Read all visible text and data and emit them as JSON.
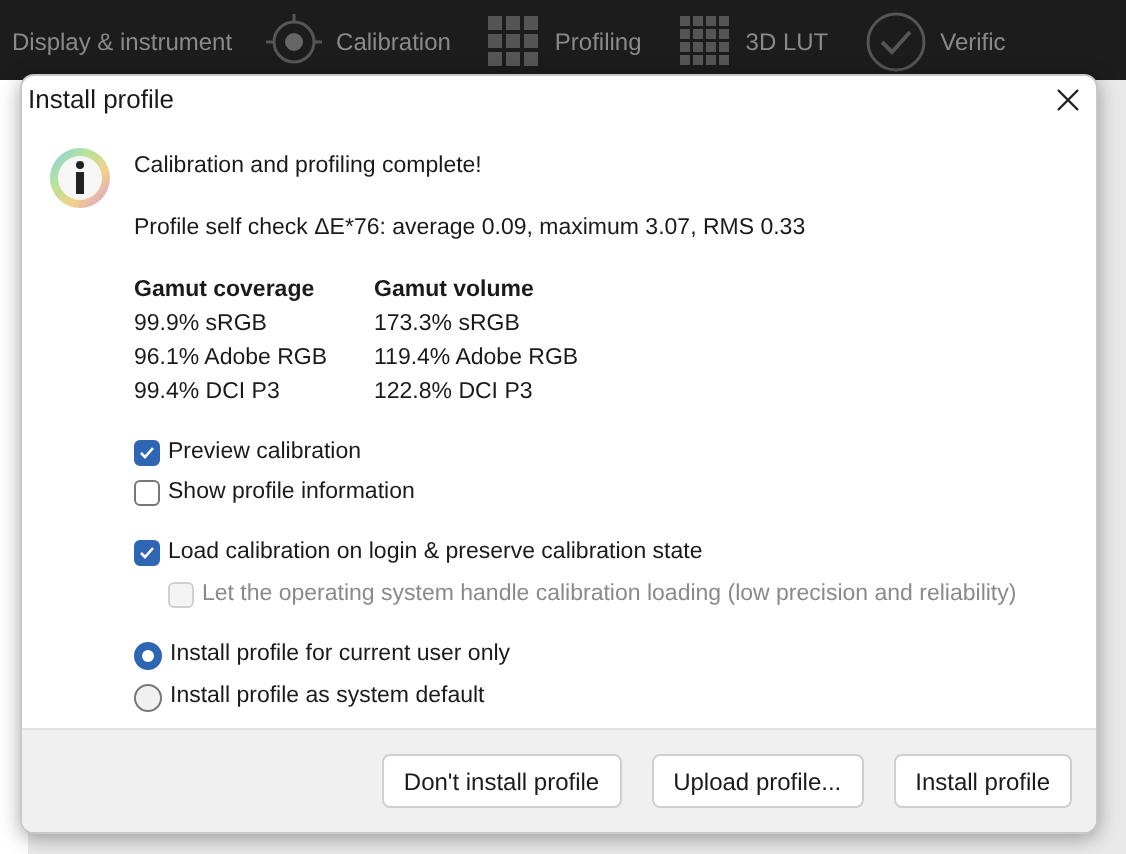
{
  "nav": [
    {
      "label": "Display & instrument",
      "kind": "text"
    },
    {
      "label": "Calibration",
      "kind": "target"
    },
    {
      "label": "Profiling",
      "kind": "grid"
    },
    {
      "label": "3D LUT",
      "kind": "cube"
    },
    {
      "label": "Verific",
      "kind": "check"
    }
  ],
  "dialog": {
    "title": "Install profile",
    "heading": "Calibration and profiling complete!",
    "self_check": "Profile self check ΔE*76: average 0.09, maximum 3.07, RMS 0.33",
    "gamut": [
      {
        "title": "Gamut coverage",
        "rows": [
          "99.9% sRGB",
          "96.1% Adobe RGB",
          "99.4% DCI P3"
        ]
      },
      {
        "title": "Gamut volume",
        "rows": [
          "173.3% sRGB",
          "119.4% Adobe RGB",
          "122.8% DCI P3"
        ]
      }
    ],
    "view_options": [
      {
        "label": "Preview calibration",
        "checked": true
      },
      {
        "label": "Show profile information",
        "checked": false
      }
    ],
    "load_option": {
      "label": "Load calibration on login & preserve calibration state",
      "checked": true
    },
    "os_option": {
      "label": "Let the operating system handle calibration loading (low precision and reliability)",
      "checked": false,
      "disabled": true
    },
    "scope": [
      {
        "label": "Install profile for current user only",
        "selected": true
      },
      {
        "label": "Install profile as system default",
        "selected": false
      }
    ],
    "buttons": [
      "Don't install profile",
      "Upload profile...",
      "Install profile"
    ]
  }
}
